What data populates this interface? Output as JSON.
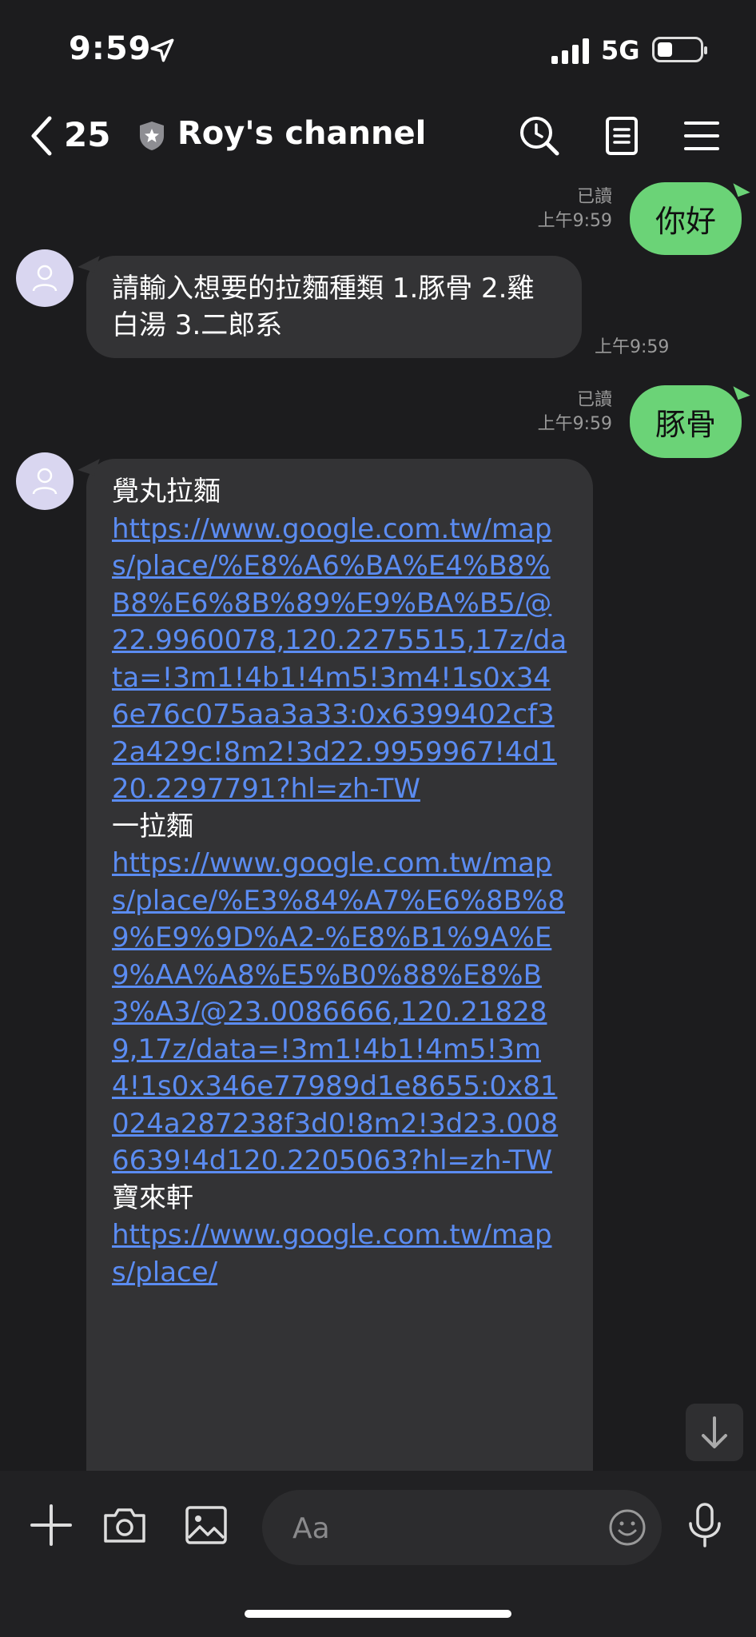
{
  "status_bar": {
    "time": "9:59",
    "network": "5G"
  },
  "header": {
    "back_count": "25",
    "channel_name": "Roy's channel"
  },
  "messages": [
    {
      "side": "out",
      "text": "你好",
      "read": "已讀",
      "time": "上午9:59"
    },
    {
      "side": "in",
      "text": "請輸入想要的拉麵種類 1.豚骨 2.雞白湯 3.二郎系",
      "time": "上午9:59"
    },
    {
      "side": "out",
      "text": "豚骨",
      "read": "已讀",
      "time": "上午9:59"
    },
    {
      "side": "in",
      "shops": [
        {
          "name": "覺丸拉麵",
          "url": "https://www.google.com.tw/maps/place/%E8%A6%BA%E4%B8%B8%E6%8B%89%E9%BA%B5/@22.9960078,120.2275515,17z/data=!3m1!4b1!4m5!3m4!1s0x346e76c075aa3a33:0x6399402cf32a429c!8m2!3d22.9959967!4d120.2297791?hl=zh-TW"
        },
        {
          "name": "一拉麵",
          "url": "https://www.google.com.tw/maps/place/%E3%84%A7%E6%8B%89%E9%9D%A2-%E8%B1%9A%E9%AA%A8%E5%B0%88%E8%B3%A3/@23.0086666,120.218289,17z/data=!3m1!4b1!4m5!3m4!1s0x346e77989d1e8655:0x81024a287238f3d0!8m2!3d23.0086639!4d120.2205063?hl=zh-TW"
        },
        {
          "name": "寶來軒",
          "url": "https://www.google.com.tw/maps/place/"
        }
      ]
    }
  ],
  "input": {
    "placeholder": "Aa"
  },
  "icons": {
    "back": "chevron-left-icon",
    "verified": "shield-icon",
    "search": "search-clock-icon",
    "notes": "notes-icon",
    "menu": "menu-icon",
    "add": "plus-icon",
    "camera": "camera-icon",
    "gallery": "image-icon",
    "emoji": "emoji-icon",
    "voice": "microphone-icon",
    "scroll": "arrow-down-icon"
  },
  "colors": {
    "background": "#1c1c1e",
    "outgoing_bubble": "#6bd377",
    "incoming_bubble": "#333335",
    "link": "#5b8cf2"
  }
}
